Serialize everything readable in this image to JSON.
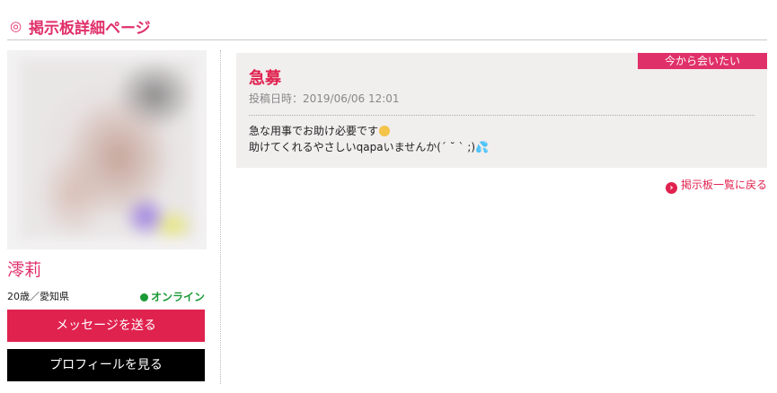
{
  "header": {
    "icon": "◎",
    "title": "掲示板詳細ページ"
  },
  "profile": {
    "name": "澪莉",
    "age_location": "20歳／愛知県",
    "online_label": "オンライン",
    "message_button": "メッセージを送る",
    "profile_button": "プロフィールを見る"
  },
  "post": {
    "tag": "今から会いたい",
    "title": "急募",
    "date": "投稿日時：2019/06/06 12:01",
    "line1": "急な用事でお助け必要です",
    "line2": "助けてくれるやさしいqapaいませんか(´ ˘ ` ;)",
    "drops_glyph": "💦"
  },
  "back_link": "掲示板一覧に戻る",
  "colors": {
    "accent": "#e0306a",
    "button": "#e0224f",
    "online": "#1a9a35",
    "panel": "#f1eeee"
  }
}
